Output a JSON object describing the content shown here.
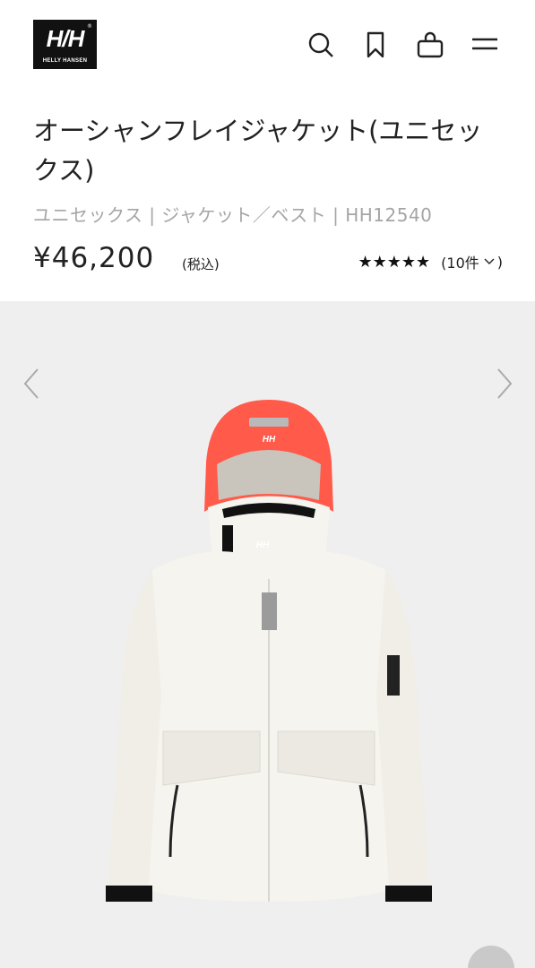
{
  "header": {
    "logo_mark": "H/H",
    "logo_sub": "HELLY HANSEN",
    "logo_reg": "®",
    "icons": [
      "search-icon",
      "bookmark-icon",
      "bag-icon",
      "menu-icon"
    ]
  },
  "product": {
    "title": "オーシャンフレイジャケット(ユニセックス)",
    "meta": "ユニセックス | ジャケット／ベスト | HH12540",
    "price": "¥46,200",
    "tax_note": "(税込)",
    "stars": "★★★★★",
    "review_count": "(10件",
    "rating": 5
  },
  "colors": {
    "hood_accent": "#ff5a4a",
    "jacket_body": "#f6f4ee",
    "gallery_bg": "#efefef"
  }
}
